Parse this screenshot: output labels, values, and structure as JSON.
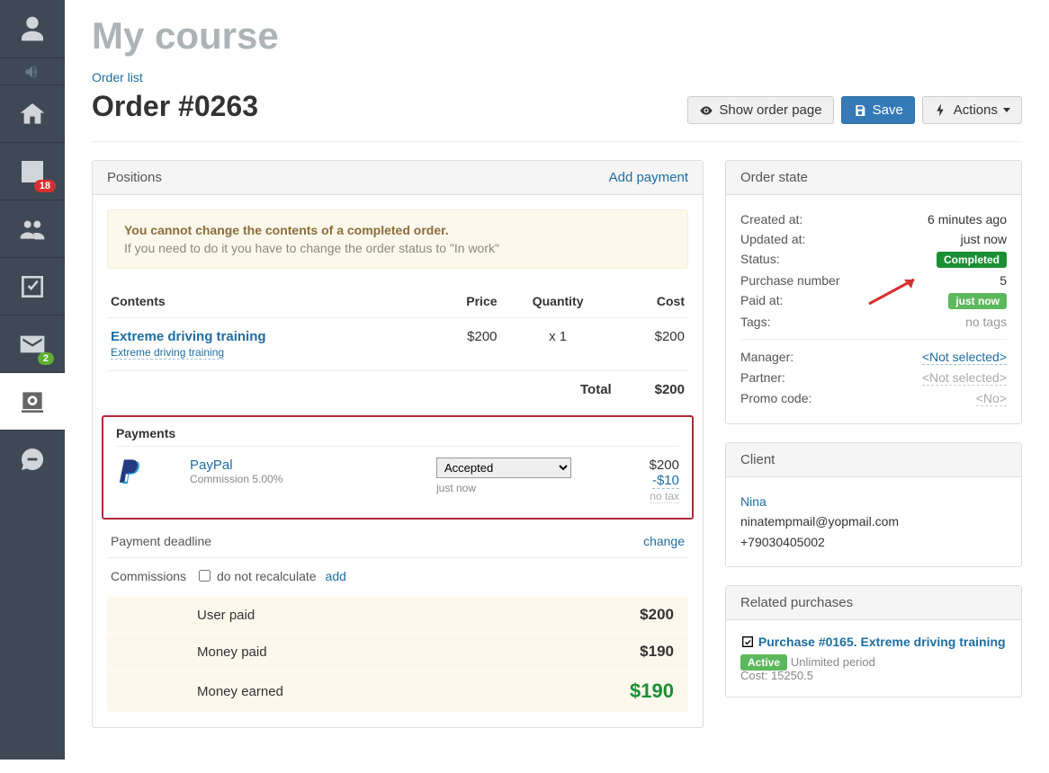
{
  "sidebar": {
    "stats_badge": "18",
    "mail_badge": "2"
  },
  "page_title": "My course",
  "breadcrumb": "Order list",
  "order_title": "Order #0263",
  "actions": {
    "show": "Show order page",
    "save": "Save",
    "actions": "Actions"
  },
  "positions": {
    "head": "Positions",
    "add_payment": "Add payment",
    "alert_title": "You cannot change the contents of a completed order.",
    "alert_sub": "If you need to do it you have to change the order status to \"In work\"",
    "cols": {
      "contents": "Contents",
      "price": "Price",
      "qty": "Quantity",
      "cost": "Cost"
    },
    "item": {
      "name": "Extreme driving training",
      "sub": "Extreme driving training",
      "price": "$200",
      "qty": "x 1",
      "cost": "$200"
    },
    "total_label": "Total",
    "total_value": "$200"
  },
  "payments": {
    "title": "Payments",
    "method": "PayPal",
    "commission_label": "Commission 5.00%",
    "status_selected": "Accepted",
    "time": "just now",
    "amount": "$200",
    "commission_amount": "-$10",
    "no_tax": "no tax"
  },
  "deadline": {
    "label": "Payment deadline",
    "change": "change"
  },
  "commissions": {
    "label": "Commissions",
    "checkbox_label": "do not recalculate",
    "add": "add"
  },
  "summary": {
    "user_paid_label": "User paid",
    "user_paid_value": "$200",
    "money_paid_label": "Money paid",
    "money_paid_value": "$190",
    "money_earned_label": "Money earned",
    "money_earned_value": "$190"
  },
  "order_state": {
    "head": "Order state",
    "created_label": "Created at:",
    "created_value": "6 minutes ago",
    "updated_label": "Updated at:",
    "updated_value": "just now",
    "status_label": "Status:",
    "status_value": "Completed",
    "pnum_label": "Purchase number",
    "pnum_value": "5",
    "paid_label": "Paid at:",
    "paid_value": "just now",
    "tags_label": "Tags:",
    "tags_value": "no tags",
    "manager_label": "Manager:",
    "manager_value": "<Not selected>",
    "partner_label": "Partner:",
    "partner_value": "<Not selected>",
    "promo_label": "Promo code:",
    "promo_value": "<No>"
  },
  "client": {
    "head": "Client",
    "name": "Nina",
    "email": "ninatempmail@yopmail.com",
    "phone": "+79030405002"
  },
  "related": {
    "head": "Related purchases",
    "title": "Purchase #0165. Extreme driving training",
    "badge": "Active",
    "period": "Unlimited period",
    "cost": "Cost: 15250.5"
  }
}
